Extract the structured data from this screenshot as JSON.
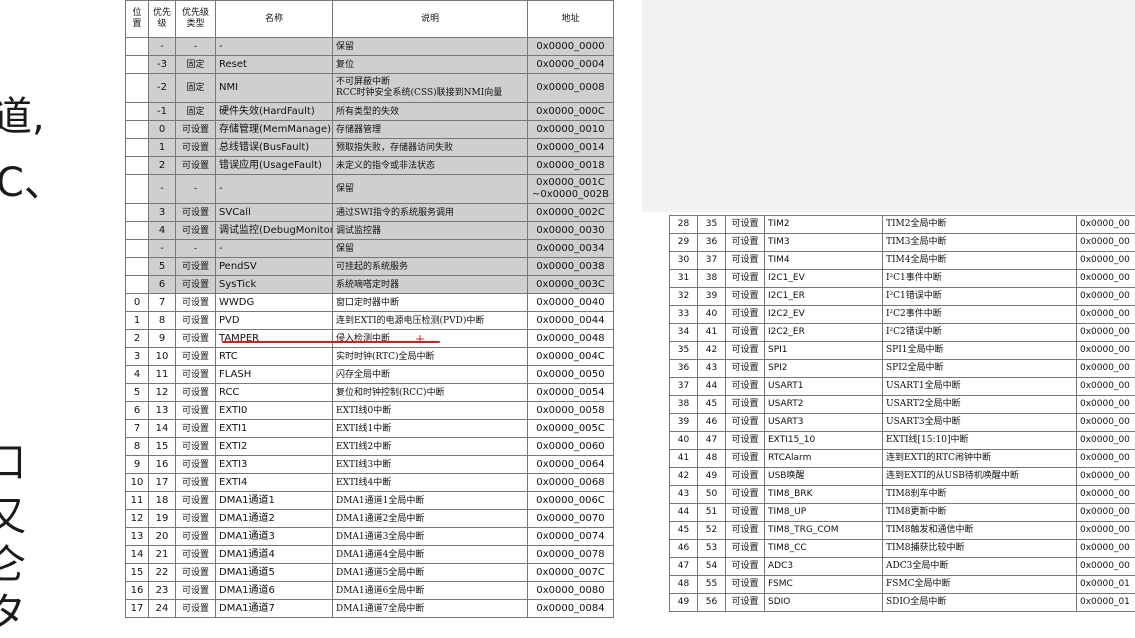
{
  "slide_fragments": [
    "道,",
    "C、",
    "口",
    "又",
    "仑",
    "タ"
  ],
  "left_table": {
    "headers": [
      "位置",
      "优先级",
      "优先级类型",
      "名称",
      "说明",
      "地址"
    ],
    "rows": [
      {
        "pos": "",
        "pri": "-",
        "type": "-",
        "name": "-",
        "desc": "保留",
        "addr": "0x0000_0000",
        "gray": true
      },
      {
        "pos": "",
        "pri": "-3",
        "type": "固定",
        "name": "Reset",
        "desc": "复位",
        "addr": "0x0000_0004",
        "gray": true
      },
      {
        "pos": "",
        "pri": "-2",
        "type": "固定",
        "name": "NMI",
        "desc": "不可屏蔽中断\nRCC时钟安全系统(CSS)联接到NMI向量",
        "addr": "0x0000_0008",
        "gray": true,
        "tall": true
      },
      {
        "pos": "",
        "pri": "-1",
        "type": "固定",
        "name": "硬件失效(HardFault)",
        "desc": "所有类型的失效",
        "addr": "0x0000_000C",
        "gray": true
      },
      {
        "pos": "",
        "pri": "0",
        "type": "可设置",
        "name": "存储管理(MemManage)",
        "desc": "存储器管理",
        "addr": "0x0000_0010",
        "gray": true
      },
      {
        "pos": "",
        "pri": "1",
        "type": "可设置",
        "name": "总线错误(BusFault)",
        "desc": "预取指失败，存储器访问失败",
        "addr": "0x0000_0014",
        "gray": true
      },
      {
        "pos": "",
        "pri": "2",
        "type": "可设置",
        "name": "错误应用(UsageFault)",
        "desc": "未定义的指令或非法状态",
        "addr": "0x0000_0018",
        "gray": true
      },
      {
        "pos": "",
        "pri": "-",
        "type": "-",
        "name": "-",
        "desc": "保留",
        "addr": "0x0000_001C\n~0x0000_002B",
        "gray": true,
        "tall": true
      },
      {
        "pos": "",
        "pri": "3",
        "type": "可设置",
        "name": "SVCall",
        "desc": "通过SWI指令的系统服务调用",
        "addr": "0x0000_002C",
        "gray": true
      },
      {
        "pos": "",
        "pri": "4",
        "type": "可设置",
        "name": "调试监控(DebugMonitor)",
        "desc": "调试监控器",
        "addr": "0x0000_0030",
        "gray": true
      },
      {
        "pos": "",
        "pri": "-",
        "type": "-",
        "name": "-",
        "desc": "保留",
        "addr": "0x0000_0034",
        "gray": true
      },
      {
        "pos": "",
        "pri": "5",
        "type": "可设置",
        "name": "PendSV",
        "desc": "可挂起的系统服务",
        "addr": "0x0000_0038",
        "gray": true
      },
      {
        "pos": "",
        "pri": "6",
        "type": "可设置",
        "name": "SysTick",
        "desc": "系统嘀嗒定时器",
        "addr": "0x0000_003C",
        "gray": true
      },
      {
        "pos": "0",
        "pri": "7",
        "type": "可设置",
        "name": "WWDG",
        "desc": "窗口定时器中断",
        "addr": "0x0000_0040"
      },
      {
        "pos": "1",
        "pri": "8",
        "type": "可设置",
        "name": "PVD",
        "desc": "连到EXTI的电源电压检测(PVD)中断",
        "addr": "0x0000_0044"
      },
      {
        "pos": "2",
        "pri": "9",
        "type": "可设置",
        "name": "TAMPER",
        "desc": "侵入检测中断",
        "addr": "0x0000_0048"
      },
      {
        "pos": "3",
        "pri": "10",
        "type": "可设置",
        "name": "RTC",
        "desc": "实时时钟(RTC)全局中断",
        "addr": "0x0000_004C"
      },
      {
        "pos": "4",
        "pri": "11",
        "type": "可设置",
        "name": "FLASH",
        "desc": "闪存全局中断",
        "addr": "0x0000_0050"
      },
      {
        "pos": "5",
        "pri": "12",
        "type": "可设置",
        "name": "RCC",
        "desc": "复位和时钟控制(RCC)中断",
        "addr": "0x0000_0054"
      },
      {
        "pos": "6",
        "pri": "13",
        "type": "可设置",
        "name": "EXTI0",
        "desc": "EXTI线0中断",
        "addr": "0x0000_0058"
      },
      {
        "pos": "7",
        "pri": "14",
        "type": "可设置",
        "name": "EXTI1",
        "desc": "EXTI线1中断",
        "addr": "0x0000_005C"
      },
      {
        "pos": "8",
        "pri": "15",
        "type": "可设置",
        "name": "EXTI2",
        "desc": "EXTI线2中断",
        "addr": "0x0000_0060"
      },
      {
        "pos": "9",
        "pri": "16",
        "type": "可设置",
        "name": "EXTI3",
        "desc": "EXTI线3中断",
        "addr": "0x0000_0064"
      },
      {
        "pos": "10",
        "pri": "17",
        "type": "可设置",
        "name": "EXTI4",
        "desc": "EXTI线4中断",
        "addr": "0x0000_0068"
      },
      {
        "pos": "11",
        "pri": "18",
        "type": "可设置",
        "name": "DMA1通道1",
        "desc": "DMA1通道1全局中断",
        "addr": "0x0000_006C"
      },
      {
        "pos": "12",
        "pri": "19",
        "type": "可设置",
        "name": "DMA1通道2",
        "desc": "DMA1通道2全局中断",
        "addr": "0x0000_0070"
      },
      {
        "pos": "13",
        "pri": "20",
        "type": "可设置",
        "name": "DMA1通道3",
        "desc": "DMA1通道3全局中断",
        "addr": "0x0000_0074"
      },
      {
        "pos": "14",
        "pri": "21",
        "type": "可设置",
        "name": "DMA1通道4",
        "desc": "DMA1通道4全局中断",
        "addr": "0x0000_0078"
      },
      {
        "pos": "15",
        "pri": "22",
        "type": "可设置",
        "name": "DMA1通道5",
        "desc": "DMA1通道5全局中断",
        "addr": "0x0000_007C"
      },
      {
        "pos": "16",
        "pri": "23",
        "type": "可设置",
        "name": "DMA1通道6",
        "desc": "DMA1通道6全局中断",
        "addr": "0x0000_0080"
      },
      {
        "pos": "17",
        "pri": "24",
        "type": "可设置",
        "name": "DMA1通道7",
        "desc": "DMA1通道7全局中断",
        "addr": "0x0000_0084"
      }
    ]
  },
  "right_table": {
    "rows": [
      {
        "pos": "28",
        "pri": "35",
        "type": "可设置",
        "name": "TIM2",
        "desc": "TIM2全局中断",
        "addr": "0x0000_00"
      },
      {
        "pos": "29",
        "pri": "36",
        "type": "可设置",
        "name": "TIM3",
        "desc": "TIM3全局中断",
        "addr": "0x0000_00"
      },
      {
        "pos": "30",
        "pri": "37",
        "type": "可设置",
        "name": "TIM4",
        "desc": "TIM4全局中断",
        "addr": "0x0000_00"
      },
      {
        "pos": "31",
        "pri": "38",
        "type": "可设置",
        "name": "I2C1_EV",
        "desc": "I²C1事件中断",
        "addr": "0x0000_00"
      },
      {
        "pos": "32",
        "pri": "39",
        "type": "可设置",
        "name": "I2C1_ER",
        "desc": "I²C1错误中断",
        "addr": "0x0000_00"
      },
      {
        "pos": "33",
        "pri": "40",
        "type": "可设置",
        "name": "I2C2_EV",
        "desc": "I²C2事件中断",
        "addr": "0x0000_00"
      },
      {
        "pos": "34",
        "pri": "41",
        "type": "可设置",
        "name": "I2C2_ER",
        "desc": "I²C2错误中断",
        "addr": "0x0000_00"
      },
      {
        "pos": "35",
        "pri": "42",
        "type": "可设置",
        "name": "SPI1",
        "desc": "SPI1全局中断",
        "addr": "0x0000_00"
      },
      {
        "pos": "36",
        "pri": "43",
        "type": "可设置",
        "name": "SPI2",
        "desc": "SPI2全局中断",
        "addr": "0x0000_00"
      },
      {
        "pos": "37",
        "pri": "44",
        "type": "可设置",
        "name": "USART1",
        "desc": "USART1全局中断",
        "addr": "0x0000_00"
      },
      {
        "pos": "38",
        "pri": "45",
        "type": "可设置",
        "name": "USART2",
        "desc": "USART2全局中断",
        "addr": "0x0000_00"
      },
      {
        "pos": "39",
        "pri": "46",
        "type": "可设置",
        "name": "USART3",
        "desc": "USART3全局中断",
        "addr": "0x0000_00"
      },
      {
        "pos": "40",
        "pri": "47",
        "type": "可设置",
        "name": "EXTI15_10",
        "desc": "EXTI线[15:10]中断",
        "addr": "0x0000_00"
      },
      {
        "pos": "41",
        "pri": "48",
        "type": "可设置",
        "name": "RTCAlarm",
        "desc": "连到EXTI的RTC闹钟中断",
        "addr": "0x0000_00"
      },
      {
        "pos": "42",
        "pri": "49",
        "type": "可设置",
        "name": "USB唤醒",
        "desc": "连到EXTI的从USB待机唤醒中断",
        "addr": "0x0000_00"
      },
      {
        "pos": "43",
        "pri": "50",
        "type": "可设置",
        "name": "TIM8_BRK",
        "desc": "TIM8刹车中断",
        "addr": "0x0000_00"
      },
      {
        "pos": "44",
        "pri": "51",
        "type": "可设置",
        "name": "TIM8_UP",
        "desc": "TIM8更新中断",
        "addr": "0x0000_00"
      },
      {
        "pos": "45",
        "pri": "52",
        "type": "可设置",
        "name": "TIM8_TRG_COM",
        "desc": "TIM8触发和通信中断",
        "addr": "0x0000_00"
      },
      {
        "pos": "46",
        "pri": "53",
        "type": "可设置",
        "name": "TIM8_CC",
        "desc": "TIM8捕获比较中断",
        "addr": "0x0000_00"
      },
      {
        "pos": "47",
        "pri": "54",
        "type": "可设置",
        "name": "ADC3",
        "desc": "ADC3全局中断",
        "addr": "0x0000_00"
      },
      {
        "pos": "48",
        "pri": "55",
        "type": "可设置",
        "name": "FSMC",
        "desc": "FSMC全局中断",
        "addr": "0x0000_01"
      },
      {
        "pos": "49",
        "pri": "56",
        "type": "可设置",
        "name": "SDIO",
        "desc": "SDIO全局中断",
        "addr": "0x0000_01"
      }
    ]
  },
  "colors": {
    "gray_row": "#cfcfcf",
    "annotation_red": "#d31f1f"
  }
}
